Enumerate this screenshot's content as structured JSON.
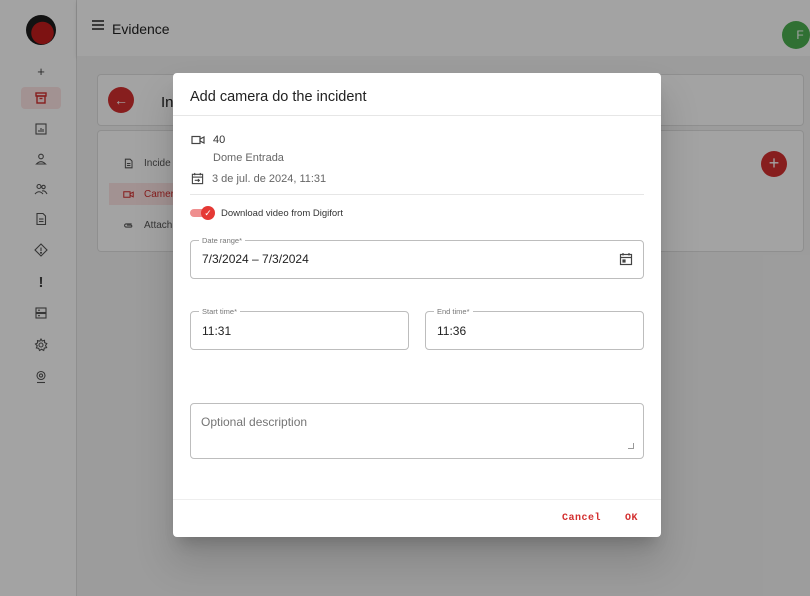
{
  "app": {
    "title": "Evidence",
    "avatar_initial": "F",
    "accent_color": "#d32f2f"
  },
  "rail": {
    "items": [
      {
        "icon": "plus-icon",
        "glyph": "+"
      },
      {
        "icon": "archive-icon",
        "active": true
      },
      {
        "icon": "chart-icon"
      },
      {
        "icon": "user-icon"
      },
      {
        "icon": "users-icon"
      },
      {
        "icon": "document-icon"
      },
      {
        "icon": "diamond-icon"
      },
      {
        "icon": "alert-icon",
        "glyph": "!"
      },
      {
        "icon": "server-icon"
      },
      {
        "icon": "settings-icon"
      },
      {
        "icon": "badge-icon"
      }
    ]
  },
  "background": {
    "header_title": "In",
    "sub_items": [
      {
        "label": "Incide",
        "icon": "document-icon"
      },
      {
        "label": "Camer",
        "icon": "camera-icon",
        "active": true
      },
      {
        "label": "Attach",
        "icon": "attachment-icon"
      }
    ],
    "add_glyph": "+"
  },
  "dialog": {
    "title": "Add camera do the incident",
    "camera_id": "40",
    "camera_name": "Dome Entrada",
    "date_text": "3 de jul. de 2024, 11:31",
    "toggle_label": "Download video from Digifort",
    "toggle_on": true,
    "date_range": {
      "label": "Date range*",
      "value": "7/3/2024 – 7/3/2024"
    },
    "start_time": {
      "label": "Start time*",
      "value": "11:31"
    },
    "end_time": {
      "label": "End time*",
      "value": "11:36"
    },
    "description": {
      "placeholder": "Optional description",
      "value": ""
    },
    "cancel_label": "Cancel",
    "ok_label": "OK"
  }
}
